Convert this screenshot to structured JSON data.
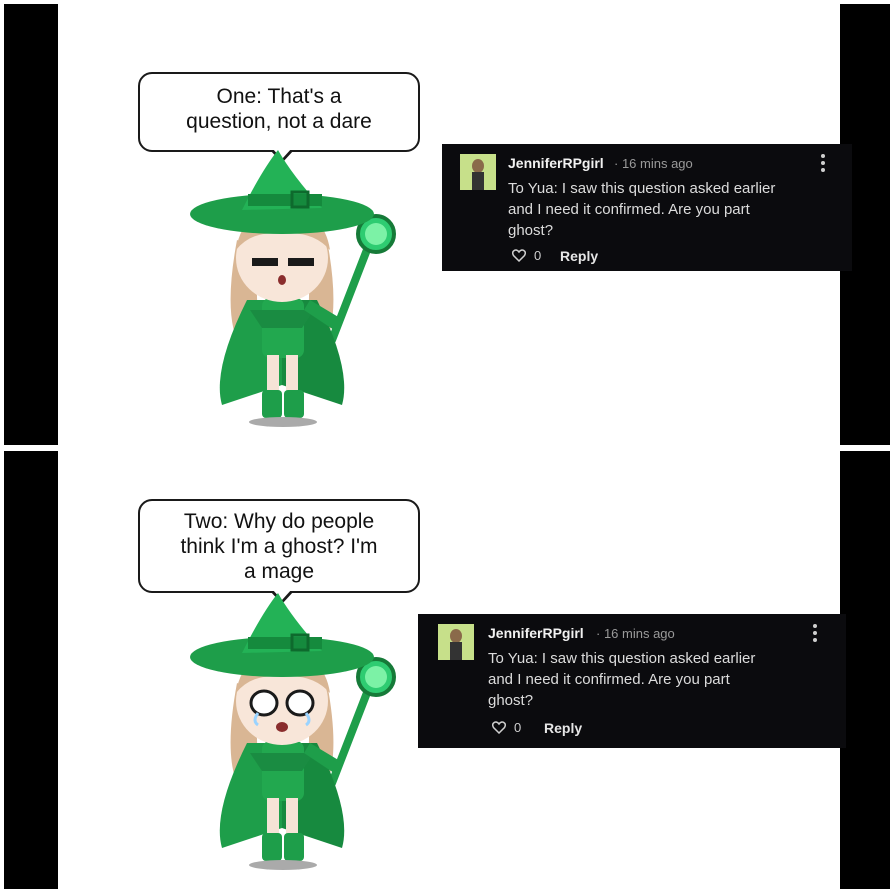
{
  "panels": [
    {
      "speech": [
        "One: That's a",
        "question, not a dare"
      ],
      "expression": "closed-eyes",
      "comment": {
        "username": "JenniferRPgirl",
        "time": "· 16 mins ago",
        "text_lines": [
          "To Yua: I saw this question asked earlier",
          "and I need it confirmed. Are you part",
          "ghost?"
        ],
        "likes": "0",
        "reply_label": "Reply"
      }
    },
    {
      "speech": [
        "Two: Why do people",
        "think I'm a ghost? I'm",
        "a mage"
      ],
      "expression": "teary-eyes",
      "comment": {
        "username": "JenniferRPgirl",
        "time": "· 16 mins ago",
        "text_lines": [
          "To Yua: I saw this question asked earlier",
          "and I need it confirmed. Are you part",
          "ghost?"
        ],
        "likes": "0",
        "reply_label": "Reply"
      }
    }
  ],
  "colors": {
    "comment_bg": "#0b0b0e",
    "outfit_green": "#1e9e4a",
    "hair": "#d9b694"
  }
}
